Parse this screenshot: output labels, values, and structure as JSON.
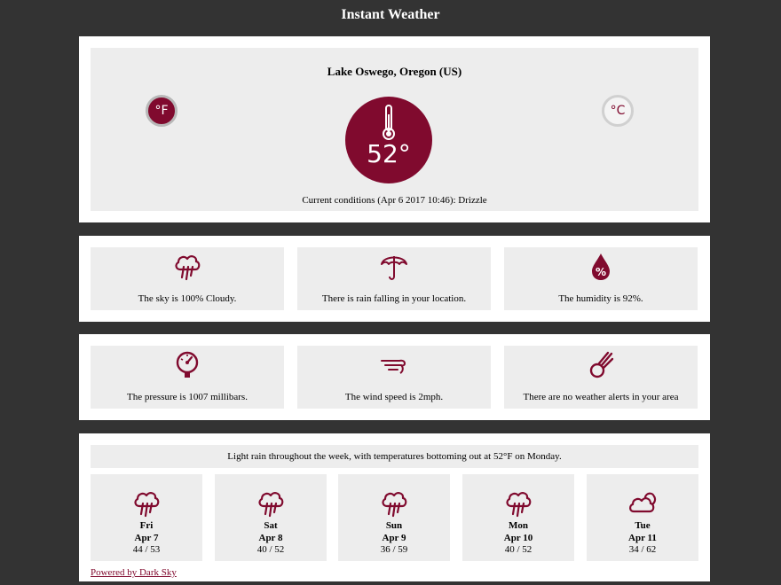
{
  "app": {
    "title": "Instant Weather"
  },
  "colors": {
    "accent": "#800a2e",
    "background": "#333333",
    "card": "#ededed"
  },
  "current": {
    "location": "Lake Oswego, Oregon (US)",
    "unit_f_label": "°F",
    "unit_c_label": "°C",
    "selected_unit": "F",
    "temperature": "52°",
    "conditions": "Current conditions (Apr 6 2017 10:46): Drizzle"
  },
  "details": [
    {
      "icon": "rain-cloud-icon",
      "text": "The sky is 100% Cloudy."
    },
    {
      "icon": "umbrella-icon",
      "text": "There is rain falling in your location."
    },
    {
      "icon": "humidity-icon",
      "text": "The humidity is 92%."
    },
    {
      "icon": "barometer-icon",
      "text": "The pressure is 1007 millibars."
    },
    {
      "icon": "wind-icon",
      "text": "The wind speed is 2mph."
    },
    {
      "icon": "comet-icon",
      "text": "There are no weather alerts in your area"
    }
  ],
  "forecast": {
    "summary": "Light rain throughout the week, with temperatures bottoming out at 52°F on Monday.",
    "days": [
      {
        "icon": "rain-cloud-icon",
        "day": "Fri",
        "date": "Apr 7",
        "range": "44 / 53"
      },
      {
        "icon": "rain-cloud-icon",
        "day": "Sat",
        "date": "Apr 8",
        "range": "40 / 52"
      },
      {
        "icon": "rain-cloud-icon",
        "day": "Sun",
        "date": "Apr 9",
        "range": "36 / 59"
      },
      {
        "icon": "rain-cloud-icon",
        "day": "Mon",
        "date": "Apr 10",
        "range": "40 / 52"
      },
      {
        "icon": "cloudy-icon",
        "day": "Tue",
        "date": "Apr 11",
        "range": "34 / 62"
      }
    ],
    "powered_by": "Powered by Dark Sky"
  }
}
